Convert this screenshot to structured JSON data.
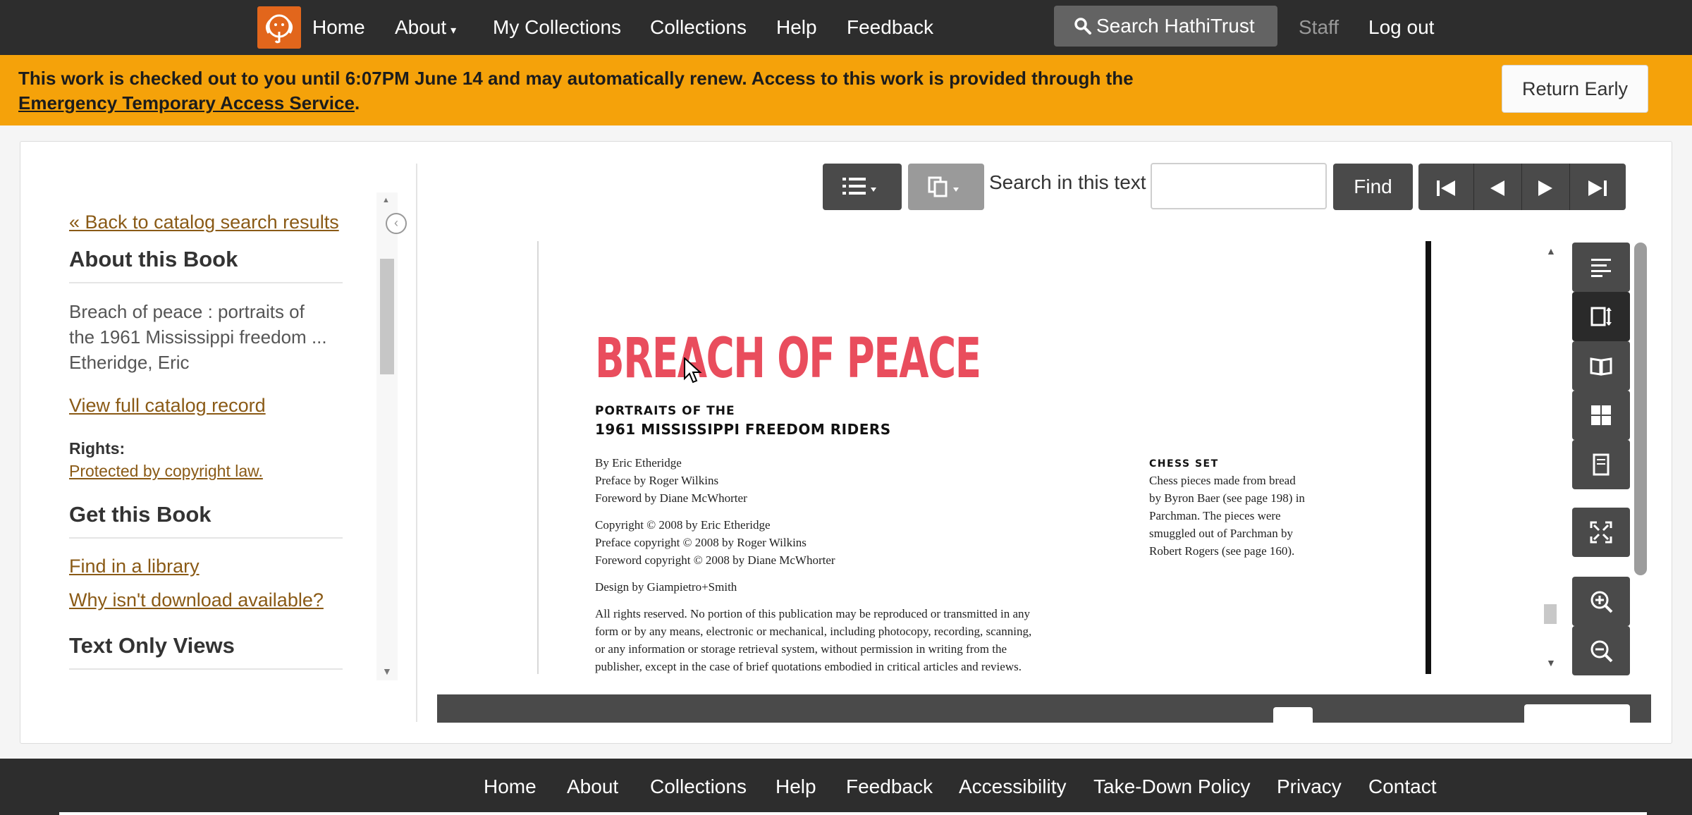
{
  "topnav": {
    "home": "Home",
    "about": "About",
    "about_caret": "▾",
    "my_collections": "My Collections",
    "collections": "Collections",
    "help": "Help",
    "feedback": "Feedback",
    "search": "Search HathiTrust",
    "staff": "Staff",
    "logout": "Log out"
  },
  "banner": {
    "message": "This work is checked out to you until 6:07PM June 14 and may automatically renew. Access to this work is provided through the",
    "link": "Emergency Temporary Access Service",
    "period": ".",
    "return_button": "Return Early",
    "color": "#f5a20a"
  },
  "sidebar": {
    "back_link": "« Back to catalog search results",
    "about_heading": "About this Book",
    "book_title_line1": "Breach of peace : portraits of",
    "book_title_line2": "the 1961 Mississippi freedom ...",
    "author": "Etheridge, Eric",
    "catalog_link": "View full catalog record",
    "rights_label": "Rights:",
    "rights_value": "Protected by copyright law.",
    "get_heading": "Get this Book",
    "library_link": "Find in a library",
    "download_link": "Why isn't download available?",
    "text_only_heading": "Text Only Views"
  },
  "toolbar": {
    "search_label": "Search in this text",
    "search_value": "",
    "find_button": "Find"
  },
  "page": {
    "title": "BREACH OF PEACE",
    "subtitle1": "PORTRAITS OF THE",
    "subtitle2": "1961 MISSISSIPPI FREEDOM RIDERS",
    "credits": [
      "By Eric Etheridge",
      "Preface by Roger Wilkins",
      "Foreword by Diane McWhorter"
    ],
    "copyrights": [
      "Copyright © 2008 by Eric Etheridge",
      "Preface copyright © 2008 by Roger Wilkins",
      "Foreword copyright © 2008 by Diane McWhorter"
    ],
    "design": "Design by Giampietro+Smith",
    "rights_text": [
      "All rights reserved. No portion of this publication may be reproduced or transmitted in any",
      "form or by any means, electronic or mechanical, including photocopy, recording, scanning,",
      "or any information or storage retrieval system, without permission in writing from the",
      "publisher, except in the case of brief quotations embodied in critical articles and reviews."
    ],
    "chess_heading": "CHESS SET",
    "chess_text": [
      "Chess pieces made from bread",
      "by Byron Baer (see page 198) in",
      "Parchman. The pieces were",
      "smuggled out of Parchman by",
      "Robert Rogers (see page 160)."
    ],
    "title_color": "#e94d5d"
  },
  "footer": {
    "home": "Home",
    "about": "About",
    "collections": "Collections",
    "help": "Help",
    "feedback": "Feedback",
    "accessibility": "Accessibility",
    "takedown": "Take-Down Policy",
    "privacy": "Privacy",
    "contact": "Contact"
  },
  "icons": {
    "logo": "elephant-logo-icon",
    "search": "search-icon",
    "contents": "list-icon",
    "select": "select-pages-icon",
    "first": "first-page-icon",
    "prev": "previous-page-icon",
    "next": "next-page-icon",
    "last": "last-page-icon",
    "views": [
      "plain-text-view-icon",
      "scroll-view-icon",
      "flip-view-icon",
      "thumbnail-view-icon",
      "page-by-page-view-icon"
    ],
    "fullscreen": "fullscreen-icon",
    "zoom_in": "zoom-in-icon",
    "zoom_out": "zoom-out-icon"
  },
  "colors": {
    "nav_bg": "#2d2d2d",
    "link": "#8a5a16",
    "button_bg": "#4a4a4a"
  }
}
